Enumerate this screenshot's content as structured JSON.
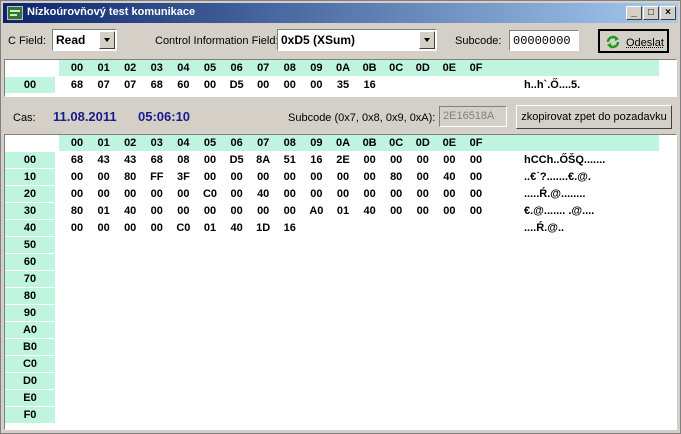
{
  "window": {
    "title": "Nízkoúrovňový test komunikace",
    "controls": {
      "minimize": "_",
      "maximize": "□",
      "close": "×"
    }
  },
  "toolbar": {
    "cfield_label": "C Field:",
    "cfield_value": "Read",
    "cif_label": "Control Information Field:",
    "cif_value": "0xD5 (XSum)",
    "subcode_label": "Subcode:",
    "subcode_value": "00000000",
    "send_label": "Odeslat",
    "send_icon": "refresh-icon"
  },
  "request": {
    "headers": [
      "00",
      "01",
      "02",
      "03",
      "04",
      "05",
      "06",
      "07",
      "08",
      "09",
      "0A",
      "0B",
      "0C",
      "0D",
      "0E",
      "0F"
    ],
    "rows": [
      {
        "label": "00",
        "bytes": [
          "68",
          "07",
          "07",
          "68",
          "60",
          "00",
          "D5",
          "00",
          "00",
          "00",
          "35",
          "16"
        ],
        "ascii": "h..h`.Ő....5."
      }
    ]
  },
  "info": {
    "cas_label": "Cas:",
    "date": "11.08.2011",
    "time": "05:06:10",
    "subcode_label": "Subcode (0x7, 0x8, 0x9, 0xA):",
    "subcode_value": "2E16518A",
    "copy_button": "zkopirovat zpet do pozadavku"
  },
  "response": {
    "headers": [
      "00",
      "01",
      "02",
      "03",
      "04",
      "05",
      "06",
      "07",
      "08",
      "09",
      "0A",
      "0B",
      "0C",
      "0D",
      "0E",
      "0F"
    ],
    "rows": [
      {
        "label": "00",
        "bytes": [
          "68",
          "43",
          "43",
          "68",
          "08",
          "00",
          "D5",
          "8A",
          "51",
          "16",
          "2E",
          "00",
          "00",
          "00",
          "00",
          "00"
        ],
        "ascii": "hCCh..ŐŠQ......."
      },
      {
        "label": "10",
        "bytes": [
          "00",
          "00",
          "80",
          "FF",
          "3F",
          "00",
          "00",
          "00",
          "00",
          "00",
          "00",
          "00",
          "80",
          "00",
          "40",
          "00"
        ],
        "ascii": "..€˙?.......€.@."
      },
      {
        "label": "20",
        "bytes": [
          "00",
          "00",
          "00",
          "00",
          "00",
          "C0",
          "00",
          "40",
          "00",
          "00",
          "00",
          "00",
          "00",
          "00",
          "00",
          "00"
        ],
        "ascii": ".....Ŕ.@........"
      },
      {
        "label": "30",
        "bytes": [
          "80",
          "01",
          "40",
          "00",
          "00",
          "00",
          "00",
          "00",
          "00",
          "A0",
          "01",
          "40",
          "00",
          "00",
          "00",
          "00"
        ],
        "ascii": "€.@....... .@...."
      },
      {
        "label": "40",
        "bytes": [
          "00",
          "00",
          "00",
          "00",
          "C0",
          "01",
          "40",
          "1D",
          "16"
        ],
        "ascii": "....Ŕ.@.."
      },
      {
        "label": "50",
        "bytes": [],
        "ascii": ""
      },
      {
        "label": "60",
        "bytes": [],
        "ascii": ""
      },
      {
        "label": "70",
        "bytes": [],
        "ascii": ""
      },
      {
        "label": "80",
        "bytes": [],
        "ascii": ""
      },
      {
        "label": "90",
        "bytes": [],
        "ascii": ""
      },
      {
        "label": "A0",
        "bytes": [],
        "ascii": ""
      },
      {
        "label": "B0",
        "bytes": [],
        "ascii": ""
      },
      {
        "label": "C0",
        "bytes": [],
        "ascii": ""
      },
      {
        "label": "D0",
        "bytes": [],
        "ascii": ""
      },
      {
        "label": "E0",
        "bytes": [],
        "ascii": ""
      },
      {
        "label": "F0",
        "bytes": [],
        "ascii": ""
      }
    ]
  },
  "colors": {
    "header_bg": "#bff5df",
    "title_start": "#0a246a",
    "title_end": "#a6caf0",
    "info_value": "#1a1a8c"
  }
}
